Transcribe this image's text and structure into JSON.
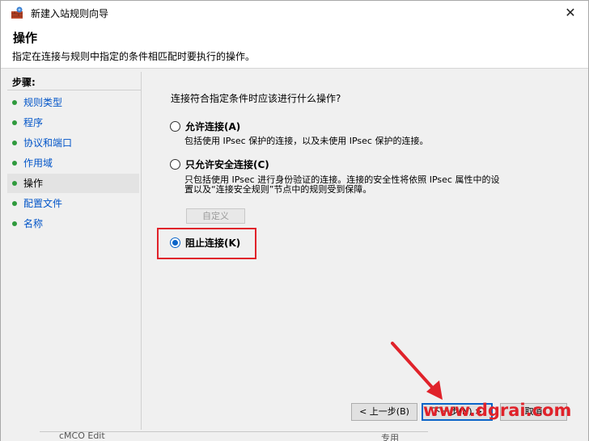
{
  "window": {
    "title": "新建入站规则向导",
    "close_glyph": "✕"
  },
  "header": {
    "title": "操作",
    "description": "指定在连接与规则中指定的条件相匹配时要执行的操作。"
  },
  "steps": {
    "title": "步骤:",
    "items": [
      {
        "label": "规则类型"
      },
      {
        "label": "程序"
      },
      {
        "label": "协议和端口"
      },
      {
        "label": "作用域"
      },
      {
        "label": "操作",
        "active": true
      },
      {
        "label": "配置文件"
      },
      {
        "label": "名称"
      }
    ]
  },
  "content": {
    "question": "连接符合指定条件时应该进行什么操作?",
    "options": [
      {
        "label": "允许连接(A)",
        "description": "包括使用 IPsec 保护的连接，以及未使用 IPsec 保护的连接。",
        "checked": false
      },
      {
        "label": "只允许安全连接(C)",
        "description_line1": "只包括使用 IPsec 进行身份验证的连接。连接的安全性将依照 IPsec 属性中的设",
        "description_line2": "置以及“连接安全规则”节点中的规则受到保障。",
        "checked": false
      },
      {
        "label": "阻止连接(K)",
        "checked": true
      }
    ],
    "customize_button": "自定义"
  },
  "buttons": {
    "back": "< 上一步(B)",
    "next": "下一步(N) >",
    "cancel": "取消"
  },
  "watermark": "www.dgrai.com",
  "background_fragment": {
    "left_text": "cMCO Edit",
    "right_text": "专用"
  },
  "colors": {
    "link_blue": "#0054c8",
    "step_dot_green": "#2f9a3d",
    "highlight_red": "#e0222a",
    "radio_blue": "#0a64c8"
  }
}
